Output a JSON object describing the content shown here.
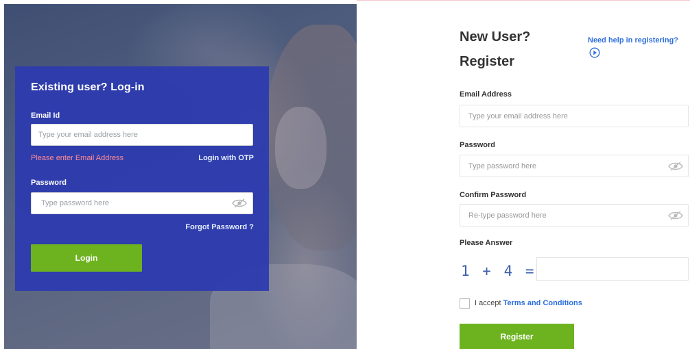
{
  "login": {
    "title": "Existing user? Log-in",
    "email_label": "Email Id",
    "email_placeholder": "Type your email address here",
    "error_text": "Please enter Email Address",
    "otp_link": "Login with OTP",
    "password_label": "Password",
    "password_placeholder": "Type password here",
    "forgot_link": "Forgot Password ?",
    "button_label": "Login"
  },
  "register": {
    "title": "New User? Register",
    "help_link": "Need help in registering?",
    "email_label": "Email Address",
    "email_placeholder": "Type your email address here",
    "password_label": "Password",
    "password_placeholder": "Type password here",
    "confirm_label": "Confirm Password",
    "confirm_placeholder": "Re-type password here",
    "answer_label": "Please Answer",
    "captcha": "1 + 4 =",
    "accept_text": "I accept ",
    "terms_link": "Terms and Conditions",
    "button_label": "Register"
  },
  "colors": {
    "login_card": "#2d3aaf",
    "button_green": "#6db31f",
    "link_blue": "#2d6fdc",
    "error_pink": "#ff8a93",
    "captcha_blue": "#3b5ea8"
  },
  "icons": {
    "login_password_toggle": "eye-off-icon",
    "register_password_toggle": "eye-off-icon",
    "register_confirm_toggle": "eye-off-icon",
    "help": "play-circle-icon"
  }
}
